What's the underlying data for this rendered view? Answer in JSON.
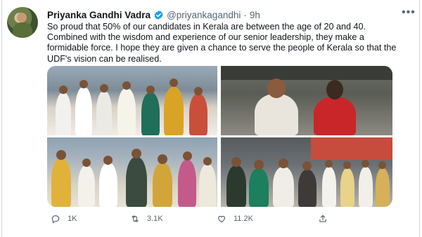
{
  "tweet": {
    "author_name": "Priyanka Gandhi Vadra",
    "handle": "@priyankagandhi",
    "separator": "·",
    "time": "9h",
    "more_glyph": "•••",
    "text": "So proud that 50% of our candidates in Kerala are between the age of 20 and 40. Combined with the wisdom and experience of our senior leadership, they make a formidable force. I hope they are given a chance to serve the people of Kerala so that the UDF's vision can be realised.",
    "verified": true
  },
  "media": {
    "tiles": [
      {
        "depicts": "rally-stage-photo"
      },
      {
        "depicts": "two-people-portrait-photo"
      },
      {
        "depicts": "waving-crowd-photo"
      },
      {
        "depicts": "group-stage-photo"
      }
    ]
  },
  "actions": {
    "reply_count": "1K",
    "retweet_count": "3.1K",
    "like_count": "11.2K",
    "icons": [
      "reply-icon",
      "retweet-icon",
      "like-icon",
      "share-icon"
    ]
  },
  "colors": {
    "text": "#0f1419",
    "secondary": "#536471",
    "verified_badge": "#1d9bf0",
    "border": "#cfd9de"
  }
}
